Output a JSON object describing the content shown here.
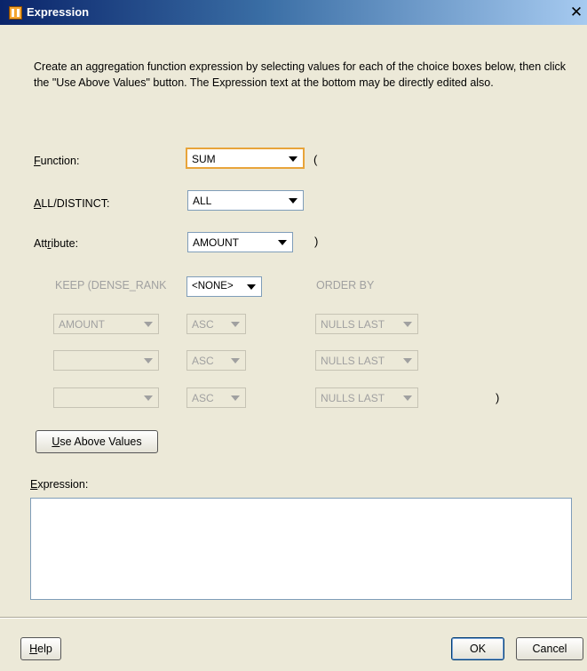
{
  "window": {
    "title": "Expression",
    "app_icon": "oracle-warehouse-icon",
    "close_icon": "close-icon"
  },
  "description": "Create an aggregation function expression by selecting values for each of the choice boxes below, then click the \"Use Above Values\" button.  The Expression text at the bottom may be directly edited also.",
  "form": {
    "function_label_mnemonic": "F",
    "function_label_rest": "unction:",
    "function_value": "SUM",
    "function_paren": "(",
    "all_distinct_label_mnemonic": "A",
    "all_distinct_label_rest": "LL/DISTINCT:",
    "all_distinct_value": "ALL",
    "attribute_label_pre": "Att",
    "attribute_label_mnemonic": "r",
    "attribute_label_rest": "ibute:",
    "attribute_value": "AMOUNT",
    "attribute_paren": ")",
    "keep_label": "KEEP (DENSE_RANK",
    "keep_value": "<NONE>",
    "order_by_label": "ORDER BY",
    "order_rows": [
      {
        "column": "AMOUNT",
        "direction": "ASC",
        "nulls": "NULLS LAST"
      },
      {
        "column": "",
        "direction": "ASC",
        "nulls": "NULLS LAST"
      },
      {
        "column": "",
        "direction": "ASC",
        "nulls": "NULLS LAST"
      }
    ],
    "order_close_paren": ")",
    "use_above_mnemonic": "U",
    "use_above_rest": "se Above Values",
    "expression_label_mnemonic": "E",
    "expression_label_rest": "xpression:",
    "expression_value": ""
  },
  "footer": {
    "help_mnemonic": "H",
    "help_rest": "elp",
    "ok_label": "OK",
    "cancel_label": "Cancel"
  },
  "colors": {
    "title_gradient_start": "#0a246a",
    "focus_border": "#e8a43a",
    "dialog_background": "#ece9d8"
  }
}
